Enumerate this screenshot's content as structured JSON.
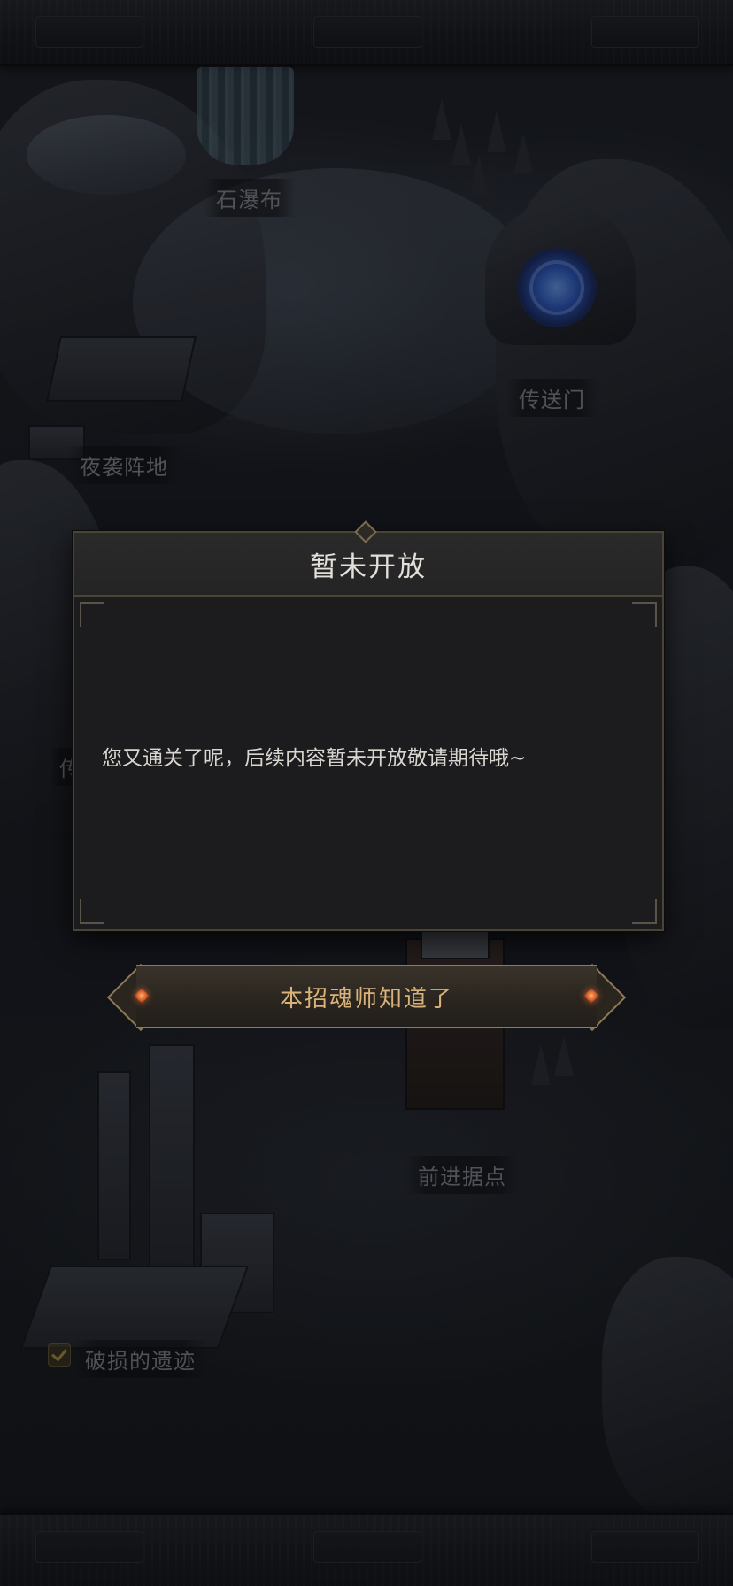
{
  "map": {
    "locations": [
      {
        "label": "石瀑布"
      },
      {
        "label": "传送门"
      },
      {
        "label": "夜袭阵地"
      },
      {
        "label": "前进据点"
      },
      {
        "label": "破损的遗迹",
        "completed": true
      }
    ],
    "partial_label": "传"
  },
  "dialog": {
    "title": "暂未开放",
    "message": "您又通关了呢，后续内容暂未开放敬请期待哦~",
    "confirm_label": "本招魂师知道了"
  },
  "colors": {
    "accent_gold": "#d9b27a",
    "dialog_bg": "#1c1c1f",
    "portal_blue": "#2f5fcf"
  }
}
